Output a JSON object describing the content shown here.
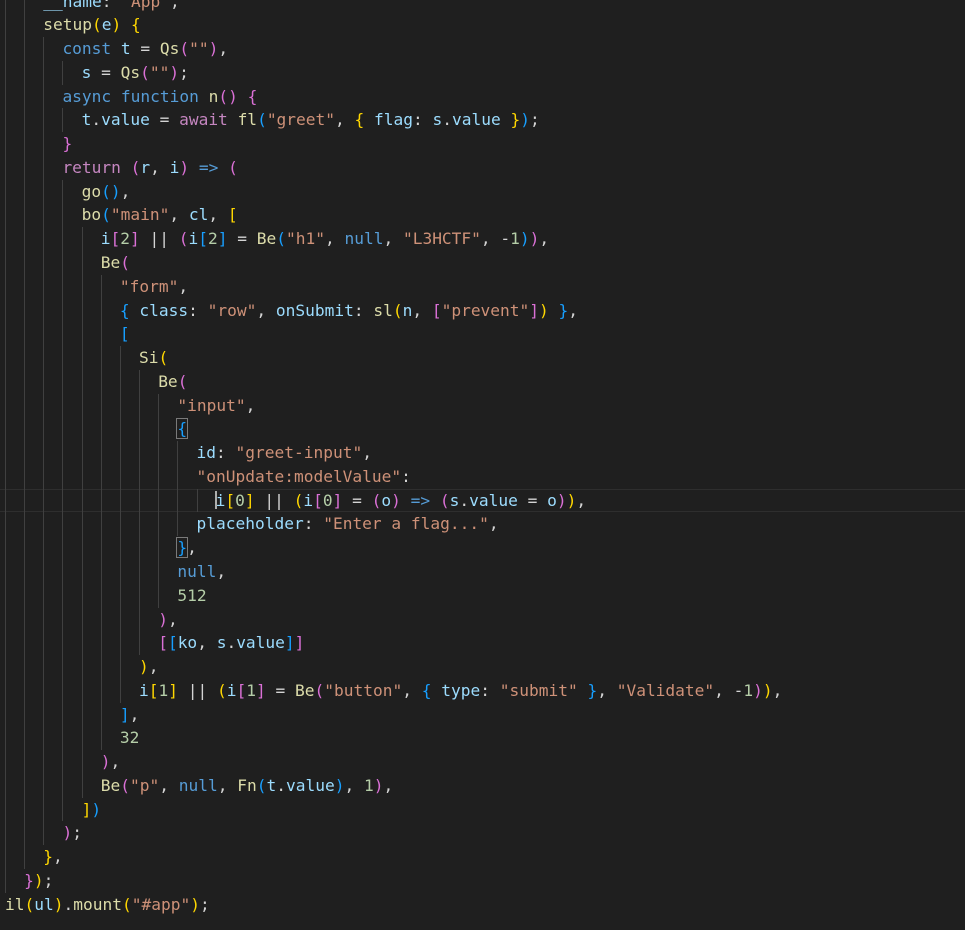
{
  "editor": {
    "language": "javascript",
    "theme": "dark",
    "colors": {
      "background": "#1f1f1f",
      "keyword": "#569cd6",
      "control_keyword": "#c586c0",
      "function": "#dcdcaa",
      "variable": "#9cdcfe",
      "string": "#ce9178",
      "number": "#b5cea8",
      "punctuation": "#d4d4d4",
      "bracket_level_1": "#ffd700",
      "bracket_level_2": "#da70d6",
      "bracket_level_3": "#179fff"
    },
    "current_line": 21,
    "lines": [
      {
        "indent": 2,
        "tokens": [
          [
            "v",
            "__name"
          ],
          [
            "p",
            ": "
          ],
          [
            "s",
            "\"App\""
          ],
          [
            "p",
            ","
          ]
        ]
      },
      {
        "indent": 2,
        "tokens": [
          [
            "f",
            "setup"
          ],
          [
            "b1",
            "("
          ],
          [
            "v",
            "e"
          ],
          [
            "b1",
            ")"
          ],
          [
            "p",
            " "
          ],
          [
            "b1",
            "{"
          ]
        ]
      },
      {
        "indent": 3,
        "tokens": [
          [
            "k",
            "const"
          ],
          [
            "p",
            " "
          ],
          [
            "v",
            "t"
          ],
          [
            "p",
            " = "
          ],
          [
            "f",
            "Qs"
          ],
          [
            "b2",
            "("
          ],
          [
            "s",
            "\"\""
          ],
          [
            "b2",
            ")"
          ],
          [
            "p",
            ","
          ]
        ]
      },
      {
        "indent": 4,
        "tokens": [
          [
            "v",
            "s"
          ],
          [
            "p",
            " = "
          ],
          [
            "f",
            "Qs"
          ],
          [
            "b2",
            "("
          ],
          [
            "s",
            "\"\""
          ],
          [
            "b2",
            ")"
          ],
          [
            "p",
            ";"
          ]
        ]
      },
      {
        "indent": 3,
        "tokens": [
          [
            "k",
            "async"
          ],
          [
            "p",
            " "
          ],
          [
            "k",
            "function"
          ],
          [
            "p",
            " "
          ],
          [
            "f",
            "n"
          ],
          [
            "b2",
            "()"
          ],
          [
            "p",
            " "
          ],
          [
            "b2",
            "{"
          ]
        ]
      },
      {
        "indent": 4,
        "tokens": [
          [
            "v",
            "t"
          ],
          [
            "p",
            "."
          ],
          [
            "v",
            "value"
          ],
          [
            "p",
            " = "
          ],
          [
            "c",
            "await"
          ],
          [
            "p",
            " "
          ],
          [
            "f",
            "fl"
          ],
          [
            "b3",
            "("
          ],
          [
            "s",
            "\"greet\""
          ],
          [
            "p",
            ", "
          ],
          [
            "b1",
            "{"
          ],
          [
            "p",
            " "
          ],
          [
            "v",
            "flag"
          ],
          [
            "p",
            ": "
          ],
          [
            "v",
            "s"
          ],
          [
            "p",
            "."
          ],
          [
            "v",
            "value"
          ],
          [
            "p",
            " "
          ],
          [
            "b1",
            "}"
          ],
          [
            "b3",
            ")"
          ],
          [
            "p",
            ";"
          ]
        ]
      },
      {
        "indent": 3,
        "tokens": [
          [
            "b2",
            "}"
          ]
        ]
      },
      {
        "indent": 3,
        "tokens": [
          [
            "c",
            "return"
          ],
          [
            "p",
            " "
          ],
          [
            "b2",
            "("
          ],
          [
            "v",
            "r"
          ],
          [
            "p",
            ", "
          ],
          [
            "v",
            "i"
          ],
          [
            "b2",
            ")"
          ],
          [
            "p",
            " "
          ],
          [
            "k",
            "=>"
          ],
          [
            "p",
            " "
          ],
          [
            "b2",
            "("
          ]
        ]
      },
      {
        "indent": 4,
        "tokens": [
          [
            "f",
            "go"
          ],
          [
            "b3",
            "()"
          ],
          [
            "p",
            ","
          ]
        ]
      },
      {
        "indent": 4,
        "tokens": [
          [
            "f",
            "bo"
          ],
          [
            "b3",
            "("
          ],
          [
            "s",
            "\"main\""
          ],
          [
            "p",
            ", "
          ],
          [
            "v",
            "cl"
          ],
          [
            "p",
            ", "
          ],
          [
            "b1",
            "["
          ]
        ]
      },
      {
        "indent": 5,
        "tokens": [
          [
            "v",
            "i"
          ],
          [
            "b2",
            "["
          ],
          [
            "n",
            "2"
          ],
          [
            "b2",
            "]"
          ],
          [
            "p",
            " || "
          ],
          [
            "b2",
            "("
          ],
          [
            "v",
            "i"
          ],
          [
            "b3",
            "["
          ],
          [
            "n",
            "2"
          ],
          [
            "b3",
            "]"
          ],
          [
            "p",
            " = "
          ],
          [
            "f",
            "Be"
          ],
          [
            "b3",
            "("
          ],
          [
            "s",
            "\"h1\""
          ],
          [
            "p",
            ", "
          ],
          [
            "k",
            "null"
          ],
          [
            "p",
            ", "
          ],
          [
            "s",
            "\"L3HCTF\""
          ],
          [
            "p",
            ", -"
          ],
          [
            "n",
            "1"
          ],
          [
            "b3",
            ")"
          ],
          [
            "b2",
            ")"
          ],
          [
            "p",
            ","
          ]
        ]
      },
      {
        "indent": 5,
        "tokens": [
          [
            "f",
            "Be"
          ],
          [
            "b2",
            "("
          ]
        ]
      },
      {
        "indent": 6,
        "tokens": [
          [
            "s",
            "\"form\""
          ],
          [
            "p",
            ","
          ]
        ]
      },
      {
        "indent": 6,
        "tokens": [
          [
            "b3",
            "{"
          ],
          [
            "p",
            " "
          ],
          [
            "v",
            "class"
          ],
          [
            "p",
            ": "
          ],
          [
            "s",
            "\"row\""
          ],
          [
            "p",
            ", "
          ],
          [
            "v",
            "onSubmit"
          ],
          [
            "p",
            ": "
          ],
          [
            "f",
            "sl"
          ],
          [
            "b1",
            "("
          ],
          [
            "v",
            "n"
          ],
          [
            "p",
            ", "
          ],
          [
            "b2",
            "["
          ],
          [
            "s",
            "\"prevent\""
          ],
          [
            "b2",
            "]"
          ],
          [
            "b1",
            ")"
          ],
          [
            "p",
            " "
          ],
          [
            "b3",
            "}"
          ],
          [
            "p",
            ","
          ]
        ]
      },
      {
        "indent": 6,
        "tokens": [
          [
            "b3",
            "["
          ]
        ]
      },
      {
        "indent": 7,
        "tokens": [
          [
            "f",
            "Si"
          ],
          [
            "b1",
            "("
          ]
        ]
      },
      {
        "indent": 8,
        "tokens": [
          [
            "f",
            "Be"
          ],
          [
            "b2",
            "("
          ]
        ]
      },
      {
        "indent": 9,
        "tokens": [
          [
            "s",
            "\"input\""
          ],
          [
            "p",
            ","
          ]
        ]
      },
      {
        "indent": 9,
        "tokens": [
          [
            "b3m",
            "{"
          ]
        ]
      },
      {
        "indent": 10,
        "tokens": [
          [
            "v",
            "id"
          ],
          [
            "p",
            ": "
          ],
          [
            "s",
            "\"greet-input\""
          ],
          [
            "p",
            ","
          ]
        ]
      },
      {
        "indent": 10,
        "tokens": [
          [
            "s",
            "\"onUpdate:modelValue\""
          ],
          [
            "p",
            ":"
          ]
        ]
      },
      {
        "indent": 11,
        "tokens": [
          [
            "cur",
            ""
          ],
          [
            "v",
            "i"
          ],
          [
            "b1",
            "["
          ],
          [
            "n",
            "0"
          ],
          [
            "b1",
            "]"
          ],
          [
            "p",
            " || "
          ],
          [
            "b1",
            "("
          ],
          [
            "v",
            "i"
          ],
          [
            "b2",
            "["
          ],
          [
            "n",
            "0"
          ],
          [
            "b2",
            "]"
          ],
          [
            "p",
            " = "
          ],
          [
            "b2",
            "("
          ],
          [
            "v",
            "o"
          ],
          [
            "b2",
            ")"
          ],
          [
            "p",
            " "
          ],
          [
            "k",
            "=>"
          ],
          [
            "p",
            " "
          ],
          [
            "b2",
            "("
          ],
          [
            "v",
            "s"
          ],
          [
            "p",
            "."
          ],
          [
            "v",
            "value"
          ],
          [
            "p",
            " = "
          ],
          [
            "v",
            "o"
          ],
          [
            "b2",
            ")"
          ],
          [
            "b1",
            ")"
          ],
          [
            "p",
            ","
          ]
        ]
      },
      {
        "indent": 10,
        "tokens": [
          [
            "v",
            "placeholder"
          ],
          [
            "p",
            ": "
          ],
          [
            "s",
            "\"Enter a flag...\""
          ],
          [
            "p",
            ","
          ]
        ]
      },
      {
        "indent": 9,
        "tokens": [
          [
            "b3m",
            "}"
          ],
          [
            "p",
            ","
          ]
        ]
      },
      {
        "indent": 9,
        "tokens": [
          [
            "k",
            "null"
          ],
          [
            "p",
            ","
          ]
        ]
      },
      {
        "indent": 9,
        "tokens": [
          [
            "n",
            "512"
          ]
        ]
      },
      {
        "indent": 8,
        "tokens": [
          [
            "b2",
            ")"
          ],
          [
            "p",
            ","
          ]
        ]
      },
      {
        "indent": 8,
        "tokens": [
          [
            "b2",
            "["
          ],
          [
            "b3",
            "["
          ],
          [
            "v",
            "ko"
          ],
          [
            "p",
            ", "
          ],
          [
            "v",
            "s"
          ],
          [
            "p",
            "."
          ],
          [
            "v",
            "value"
          ],
          [
            "b3",
            "]"
          ],
          [
            "b2",
            "]"
          ]
        ]
      },
      {
        "indent": 7,
        "tokens": [
          [
            "b1",
            ")"
          ],
          [
            "p",
            ","
          ]
        ]
      },
      {
        "indent": 7,
        "tokens": [
          [
            "v",
            "i"
          ],
          [
            "b1",
            "["
          ],
          [
            "n",
            "1"
          ],
          [
            "b1",
            "]"
          ],
          [
            "p",
            " || "
          ],
          [
            "b1",
            "("
          ],
          [
            "v",
            "i"
          ],
          [
            "b2",
            "["
          ],
          [
            "n",
            "1"
          ],
          [
            "b2",
            "]"
          ],
          [
            "p",
            " = "
          ],
          [
            "f",
            "Be"
          ],
          [
            "b2",
            "("
          ],
          [
            "s",
            "\"button\""
          ],
          [
            "p",
            ", "
          ],
          [
            "b3",
            "{"
          ],
          [
            "p",
            " "
          ],
          [
            "v",
            "type"
          ],
          [
            "p",
            ": "
          ],
          [
            "s",
            "\"submit\""
          ],
          [
            "p",
            " "
          ],
          [
            "b3",
            "}"
          ],
          [
            "p",
            ", "
          ],
          [
            "s",
            "\"Validate\""
          ],
          [
            "p",
            ", -"
          ],
          [
            "n",
            "1"
          ],
          [
            "b2",
            ")"
          ],
          [
            "b1",
            ")"
          ],
          [
            "p",
            ","
          ]
        ]
      },
      {
        "indent": 6,
        "tokens": [
          [
            "b3",
            "]"
          ],
          [
            "p",
            ","
          ]
        ]
      },
      {
        "indent": 6,
        "tokens": [
          [
            "n",
            "32"
          ]
        ]
      },
      {
        "indent": 5,
        "tokens": [
          [
            "b2",
            ")"
          ],
          [
            "p",
            ","
          ]
        ]
      },
      {
        "indent": 5,
        "tokens": [
          [
            "f",
            "Be"
          ],
          [
            "b2",
            "("
          ],
          [
            "s",
            "\"p\""
          ],
          [
            "p",
            ", "
          ],
          [
            "k",
            "null"
          ],
          [
            "p",
            ", "
          ],
          [
            "f",
            "Fn"
          ],
          [
            "b3",
            "("
          ],
          [
            "v",
            "t"
          ],
          [
            "p",
            "."
          ],
          [
            "v",
            "value"
          ],
          [
            "b3",
            ")"
          ],
          [
            "p",
            ", "
          ],
          [
            "n",
            "1"
          ],
          [
            "b2",
            ")"
          ],
          [
            "p",
            ","
          ]
        ]
      },
      {
        "indent": 4,
        "tokens": [
          [
            "b1",
            "]"
          ],
          [
            "b3",
            ")"
          ]
        ]
      },
      {
        "indent": 3,
        "tokens": [
          [
            "b2",
            ")"
          ],
          [
            "p",
            ";"
          ]
        ]
      },
      {
        "indent": 2,
        "tokens": [
          [
            "b1",
            "}"
          ],
          [
            "p",
            ","
          ]
        ]
      },
      {
        "indent": 1,
        "tokens": [
          [
            "b2",
            "}"
          ],
          [
            "b1",
            ")"
          ],
          [
            "p",
            ";"
          ]
        ]
      },
      {
        "indent": 0,
        "tokens": [
          [
            "f",
            "il"
          ],
          [
            "b1",
            "("
          ],
          [
            "v",
            "ul"
          ],
          [
            "b1",
            ")"
          ],
          [
            "p",
            "."
          ],
          [
            "f",
            "mount"
          ],
          [
            "b1",
            "("
          ],
          [
            "s",
            "\"#app\""
          ],
          [
            "b1",
            ")"
          ],
          [
            "p",
            ";"
          ]
        ]
      }
    ]
  }
}
